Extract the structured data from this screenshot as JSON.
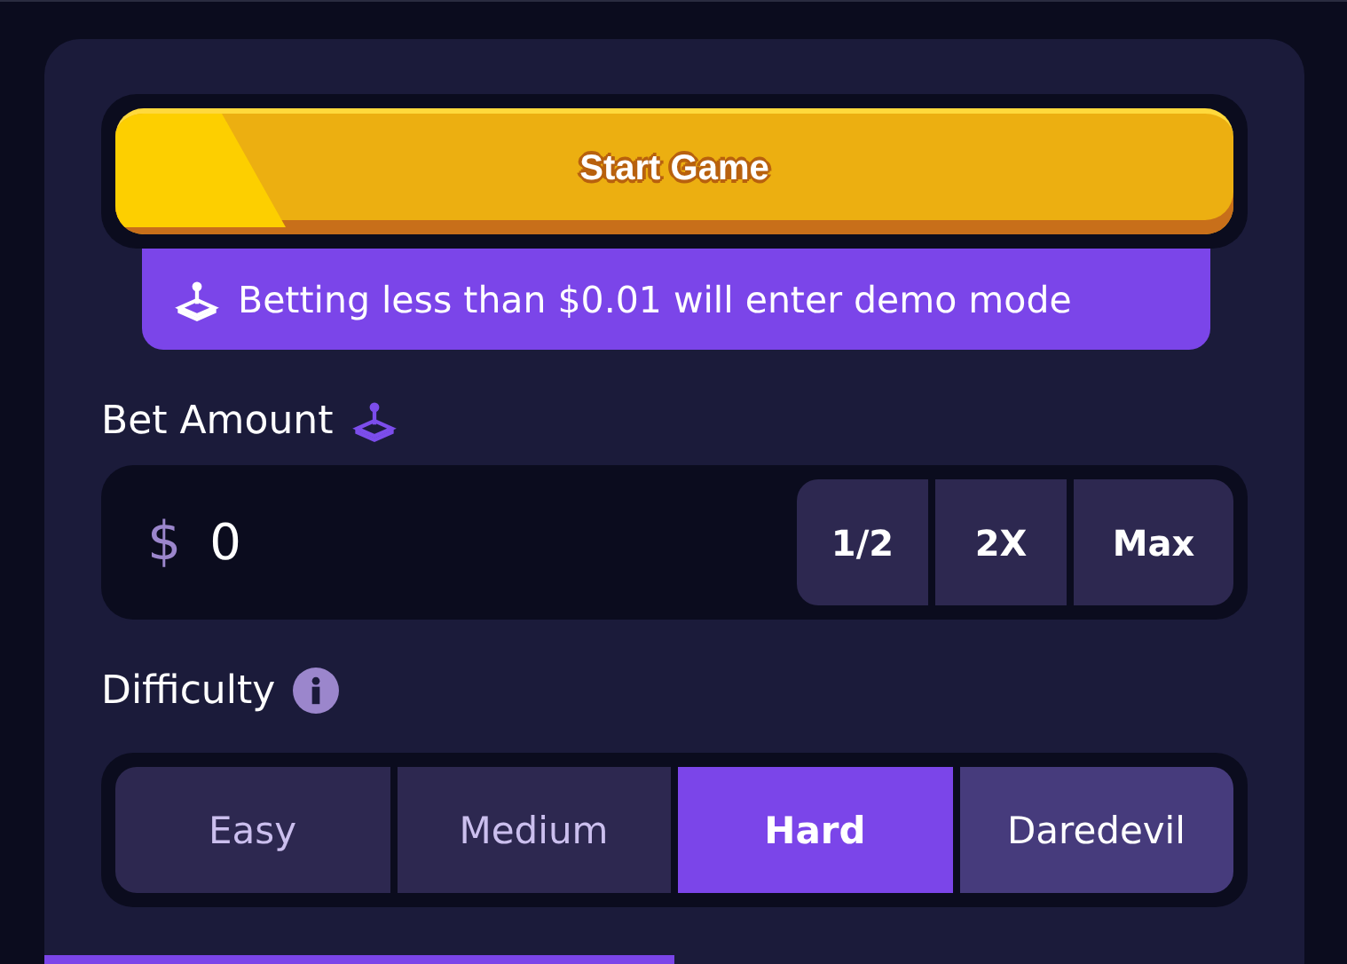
{
  "start_button": {
    "label": "Start Game"
  },
  "demo_notice": {
    "text": "Betting less than $0.01 will enter demo mode"
  },
  "bet_amount": {
    "label": "Bet Amount",
    "currency": "$",
    "value": "0",
    "buttons": [
      "1/2",
      "2X",
      "Max"
    ]
  },
  "difficulty": {
    "label": "Difficulty",
    "options": [
      {
        "label": "Easy",
        "selected": false,
        "hovered": false
      },
      {
        "label": "Medium",
        "selected": false,
        "hovered": false
      },
      {
        "label": "Hard",
        "selected": true,
        "hovered": false
      },
      {
        "label": "Daredevil",
        "selected": false,
        "hovered": true
      }
    ]
  }
}
